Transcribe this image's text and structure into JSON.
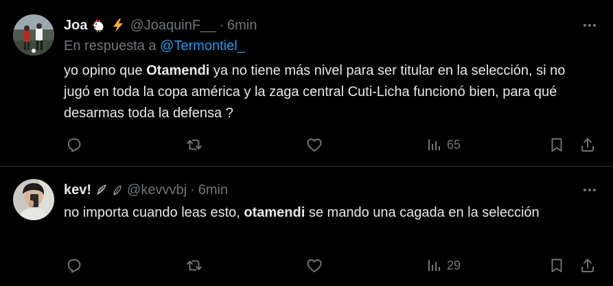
{
  "colors": {
    "background": "#000000",
    "text_primary": "#e7e9ea",
    "text_secondary": "#71767b",
    "link": "#1d9bf0",
    "divider": "#2f3336"
  },
  "tweets": [
    {
      "display_name": "Joa",
      "name_emojis": [
        "rooster-emoji",
        "lightning-emoji"
      ],
      "handle": "@JoaquinF__",
      "separator": "·",
      "time": "6min",
      "reply_prefix": "En respuesta a",
      "reply_mention": "@Termontiel_",
      "text_parts": [
        "yo opino que ",
        "Otamendi",
        " ya no tiene más nivel para ser titular en la selección, si no jugó en toda la copa américa y la zaga central Cuti-Licha funcionó bien, para qué desarmas toda la defensa ?"
      ],
      "views": "65"
    },
    {
      "display_name": "kev!",
      "name_emojis": [
        "feather-emoji",
        "leaf-emoji"
      ],
      "handle": "@kevvvbj",
      "separator": "·",
      "time": "6min",
      "text_parts": [
        "no importa cuando leas esto, ",
        "otamendi",
        " se mando una cagada en la selección"
      ],
      "views": "29"
    }
  ]
}
